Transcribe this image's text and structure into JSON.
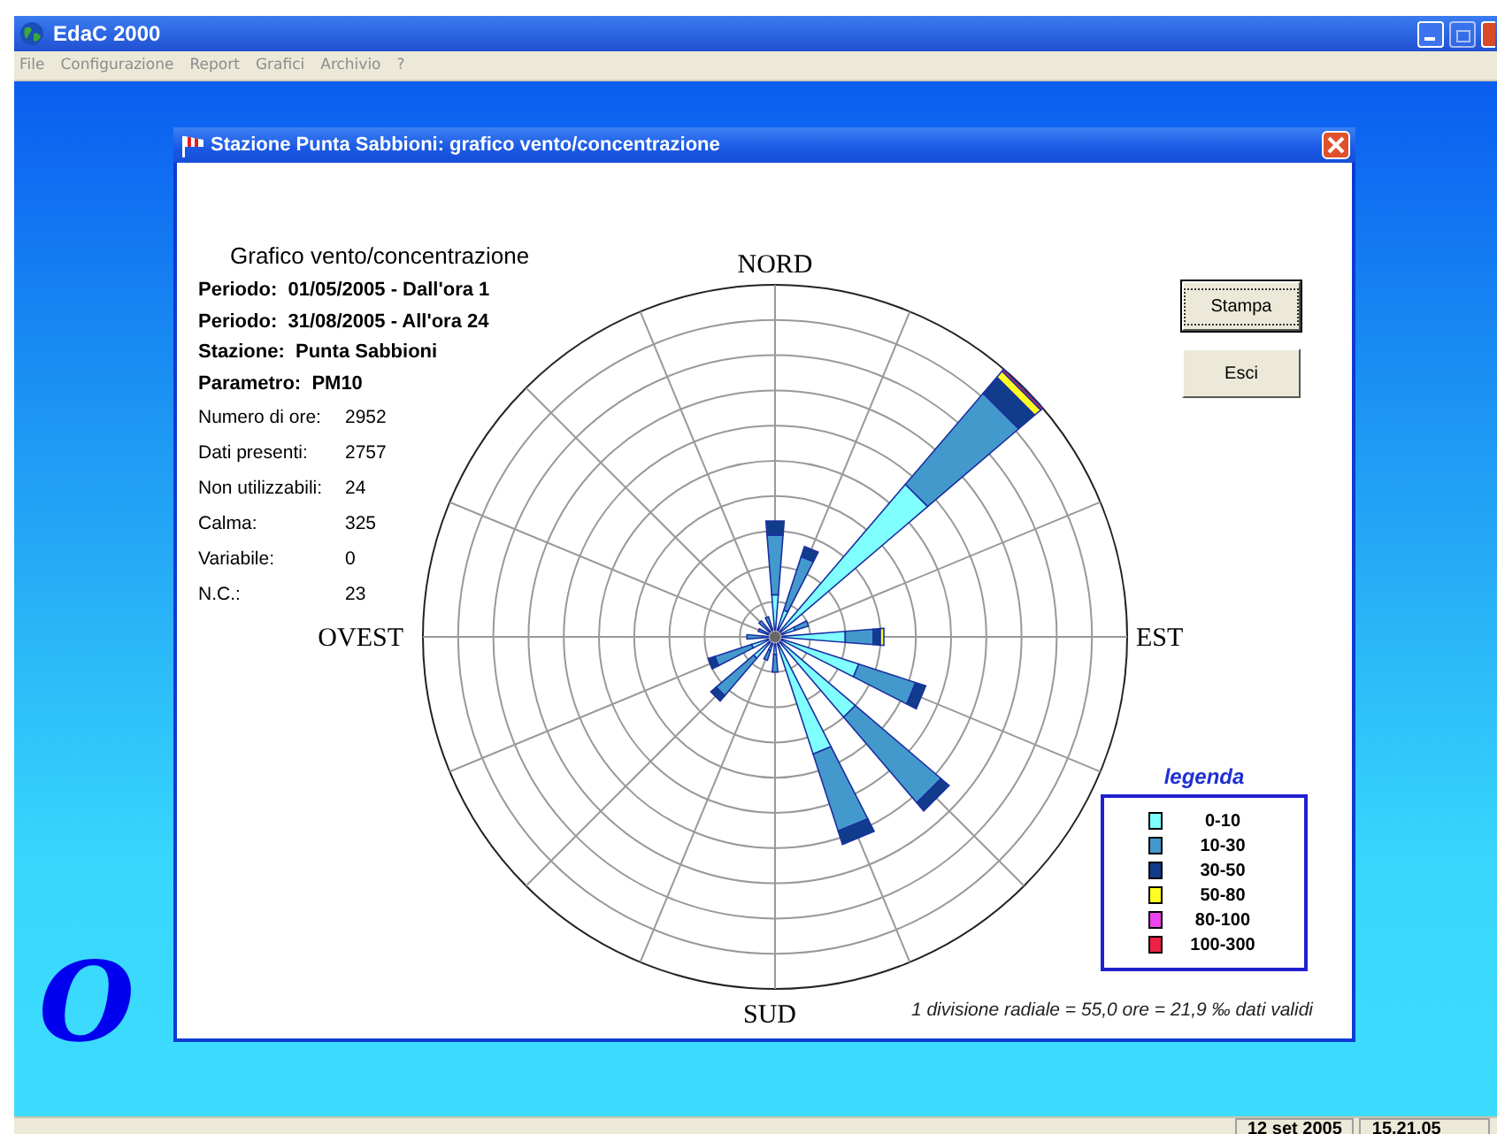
{
  "app": {
    "title": "EdaC 2000"
  },
  "menu": [
    {
      "label": "File",
      "disabled": true
    },
    {
      "label": "Configurazione",
      "disabled": true
    },
    {
      "label": "Report",
      "disabled": true
    },
    {
      "label": "Grafici",
      "disabled": true
    },
    {
      "label": "Archivio",
      "disabled": true
    },
    {
      "label": "?",
      "disabled": true
    }
  ],
  "logo": {
    "text": "O"
  },
  "dialog": {
    "title": "Stazione Punta Sabbioni: grafico vento/concentrazione",
    "heading": "Grafico vento/concentrazione",
    "info_lines": [
      "Periodo:  01/05/2005 - Dall'ora 1",
      "Periodo:  31/08/2005 - All'ora 24",
      "Stazione:  Punta Sabbioni",
      "Parametro:  PM10"
    ],
    "stats": [
      {
        "label": "Numero di ore:",
        "value": "2952"
      },
      {
        "label": "Dati presenti:",
        "value": "2757"
      },
      {
        "label": "Non utilizzabili:",
        "value": "24"
      },
      {
        "label": "Calma:",
        "value": "325"
      },
      {
        "label": "Variabile:",
        "value": "0"
      },
      {
        "label": "N.C.:",
        "value": "23"
      }
    ],
    "directions": {
      "north": "NORD",
      "east": "EST",
      "south": "SUD",
      "west": "OVEST"
    },
    "buttons": [
      {
        "label": "Stampa",
        "focused": true
      },
      {
        "label": "Esci",
        "focused": false
      }
    ],
    "legend": {
      "title": "legenda",
      "items": [
        {
          "label": "0-10",
          "color": "#80ffff"
        },
        {
          "label": "10-30",
          "color": "#4499cc"
        },
        {
          "label": "30-50",
          "color": "#113c8c"
        },
        {
          "label": "50-80",
          "color": "#ffff22"
        },
        {
          "label": "80-100",
          "color": "#ee44ee"
        },
        {
          "label": "100-300",
          "color": "#ee2244"
        }
      ]
    },
    "footnote": "1 divisione radiale = 55,0 ore = 21,9 ‰ dati validi"
  },
  "status_bar": {
    "date": "12 set 2005",
    "time": "15.21.05"
  }
}
